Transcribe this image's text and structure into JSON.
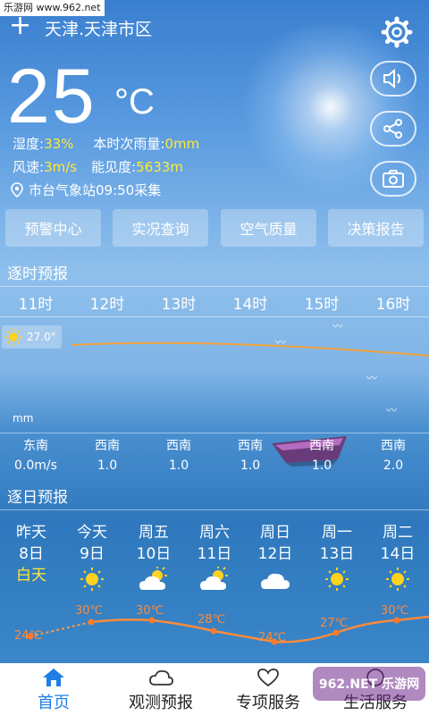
{
  "watermark_top": "乐游网 www.962.net",
  "watermark_br": "962.NET 乐游网",
  "header": {
    "city": "天津.天津市区",
    "add_icon": "+"
  },
  "current": {
    "temperature": "25",
    "unit": "°C",
    "humidity_label": "湿度:",
    "humidity": "33%",
    "rain_label": "本时次雨量:",
    "rain": "0mm",
    "wind_label": "风速:",
    "wind": "3m/s",
    "visibility_label": "能见度:",
    "visibility": "5633m",
    "station": "市台气象站09:50采集"
  },
  "quick_buttons": [
    "预警中心",
    "实况查询",
    "空气质量",
    "决策报告"
  ],
  "hourly": {
    "title": "逐时预报",
    "hours": [
      "11时",
      "12时",
      "13时",
      "14时",
      "15时",
      "16时"
    ],
    "temp_badge": "27.0°",
    "unit": "mm",
    "wind_dirs": [
      "东南",
      "西南",
      "西南",
      "西南",
      "西南",
      "西南"
    ],
    "wind_speeds": [
      "0.0m/s",
      "1.0",
      "1.0",
      "1.0",
      "1.0",
      "2.0"
    ]
  },
  "daily": {
    "title": "逐日预报",
    "days": [
      {
        "name": "昨天",
        "date": "8日",
        "sub": "白天",
        "icon": ""
      },
      {
        "name": "今天",
        "date": "9日",
        "sub": "",
        "icon": "sun-icon"
      },
      {
        "name": "周五",
        "date": "10日",
        "sub": "",
        "icon": "cloud-sun-icon"
      },
      {
        "name": "周六",
        "date": "11日",
        "sub": "",
        "icon": "cloud-sun-icon"
      },
      {
        "name": "周日",
        "date": "12日",
        "sub": "",
        "icon": "cloud-icon"
      },
      {
        "name": "周一",
        "date": "13日",
        "sub": "",
        "icon": "sun-icon"
      },
      {
        "name": "周二",
        "date": "14日",
        "sub": "",
        "icon": "sun-icon"
      }
    ],
    "temps": [
      "24℃",
      "30℃",
      "30℃",
      "28℃",
      "24℃",
      "27℃",
      "30℃"
    ]
  },
  "nav": [
    "首页",
    "观测预报",
    "专项服务",
    "生活服务"
  ],
  "colors": {
    "accent_yellow": "#ffe93a",
    "temp_line": "#ff8a3a",
    "nav_active": "#1f7ee6"
  }
}
